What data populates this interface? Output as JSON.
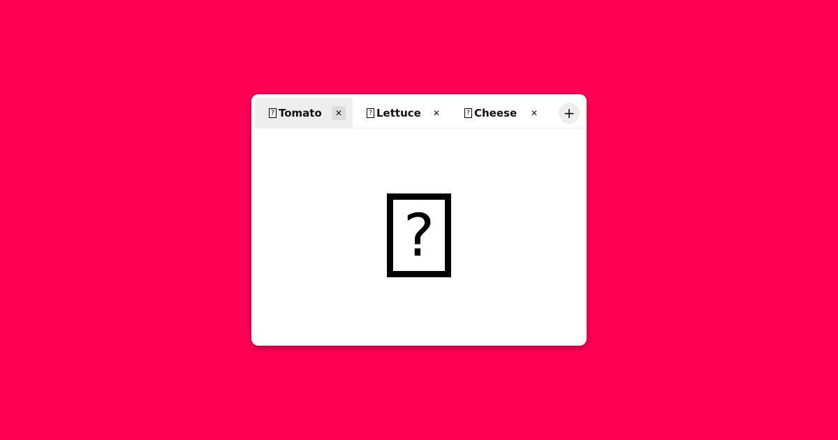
{
  "tabs": [
    {
      "icon": "?",
      "label": "Tomato",
      "close": "✕",
      "selected": true
    },
    {
      "icon": "?",
      "label": "Lettuce",
      "close": "✕",
      "selected": false
    },
    {
      "icon": "?",
      "label": "Cheese",
      "close": "✕",
      "selected": false
    }
  ],
  "add_button": {
    "label": "+"
  },
  "content": {
    "icon": "?",
    "icon_name": "missing-glyph-icon"
  },
  "colors": {
    "background": "#ff0055",
    "window": "#ffffff",
    "selected_tab": "#eeeeee"
  }
}
